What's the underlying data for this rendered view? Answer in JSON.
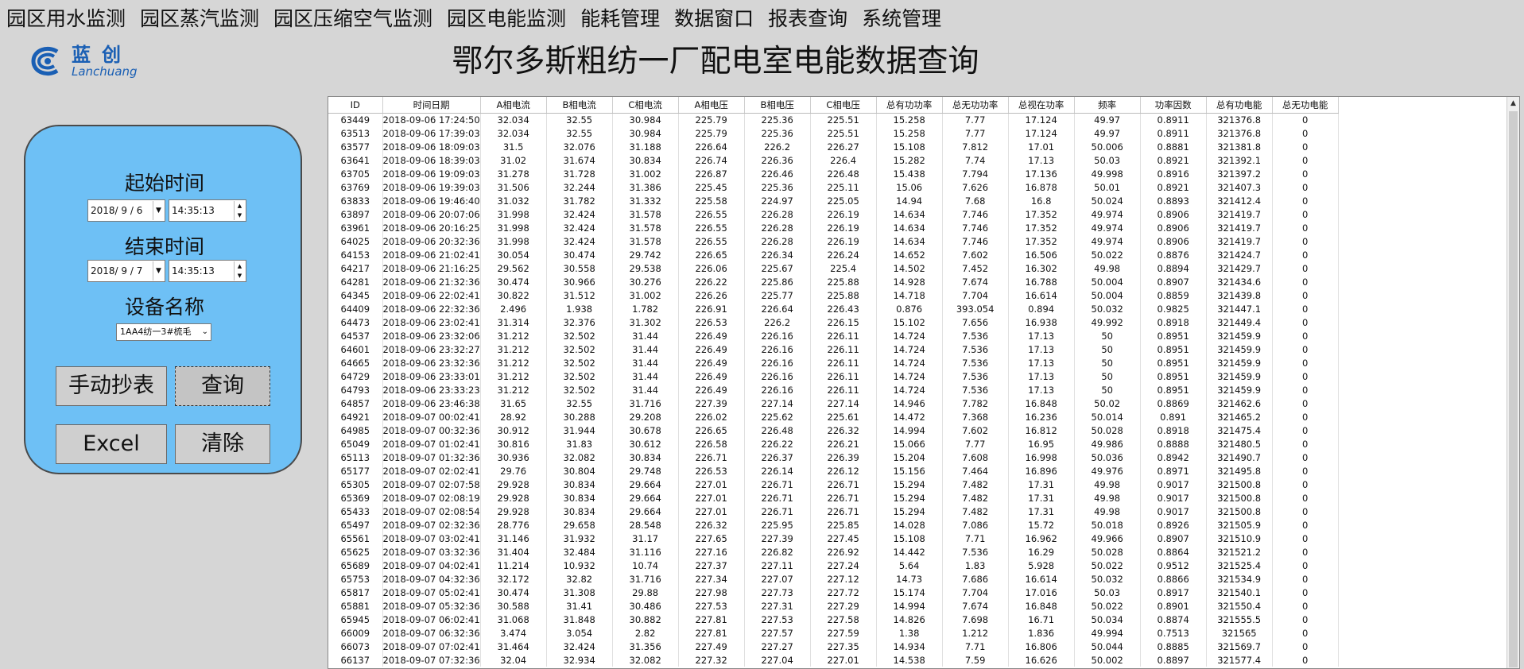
{
  "menu": [
    "园区用水监测",
    "园区蒸汽监测",
    "园区压缩空气监测",
    "园区电能监测",
    "能耗管理",
    "数据窗口",
    "报表查询",
    "系统管理"
  ],
  "logo": {
    "cn": "蓝创",
    "en": "Lanchuang",
    "brand_color": "#1a5fb4"
  },
  "page_title": "鄂尔多斯粗纺一厂配电室电能数据查询",
  "panel": {
    "start_label": "起始时间",
    "start_date": "2018/ 9 / 6",
    "start_time": "14:35:13",
    "end_label": "结束时间",
    "end_date": "2018/ 9 / 7",
    "end_time": "14:35:13",
    "device_label": "设备名称",
    "device_value": "1AA4纺一3#梳毛",
    "manual_read_btn": "手动抄表",
    "query_btn": "查询",
    "excel_btn": "Excel",
    "clear_btn": "清除",
    "bg_color": "#6ec0f5"
  },
  "table": {
    "columns": [
      "ID",
      "时间日期",
      "A相电流",
      "B相电流",
      "C相电流",
      "A相电压",
      "B相电压",
      "C相电压",
      "总有功功率",
      "总无功功率",
      "总视在功率",
      "频率",
      "功率因数",
      "总有功电能",
      "总无功电能"
    ],
    "rows": [
      [
        "63449",
        "2018-09-06 17:24:50",
        "32.034",
        "32.55",
        "30.984",
        "225.79",
        "225.36",
        "225.51",
        "15.258",
        "7.77",
        "17.124",
        "49.97",
        "0.8911",
        "321376.8",
        "0"
      ],
      [
        "63513",
        "2018-09-06 17:39:03",
        "32.034",
        "32.55",
        "30.984",
        "225.79",
        "225.36",
        "225.51",
        "15.258",
        "7.77",
        "17.124",
        "49.97",
        "0.8911",
        "321376.8",
        "0"
      ],
      [
        "63577",
        "2018-09-06 18:09:03",
        "31.5",
        "32.076",
        "31.188",
        "226.64",
        "226.2",
        "226.27",
        "15.108",
        "7.812",
        "17.01",
        "50.006",
        "0.8881",
        "321381.8",
        "0"
      ],
      [
        "63641",
        "2018-09-06 18:39:03",
        "31.02",
        "31.674",
        "30.834",
        "226.74",
        "226.36",
        "226.4",
        "15.282",
        "7.74",
        "17.13",
        "50.03",
        "0.8921",
        "321392.1",
        "0"
      ],
      [
        "63705",
        "2018-09-06 19:09:03",
        "31.278",
        "31.728",
        "31.002",
        "226.87",
        "226.46",
        "226.48",
        "15.438",
        "7.794",
        "17.136",
        "49.998",
        "0.8916",
        "321397.2",
        "0"
      ],
      [
        "63769",
        "2018-09-06 19:39:03",
        "31.506",
        "32.244",
        "31.386",
        "225.45",
        "225.36",
        "225.11",
        "15.06",
        "7.626",
        "16.878",
        "50.01",
        "0.8921",
        "321407.3",
        "0"
      ],
      [
        "63833",
        "2018-09-06 19:46:40",
        "31.032",
        "31.782",
        "31.332",
        "225.58",
        "224.97",
        "225.05",
        "14.94",
        "7.68",
        "16.8",
        "50.024",
        "0.8893",
        "321412.4",
        "0"
      ],
      [
        "63897",
        "2018-09-06 20:07:06",
        "31.998",
        "32.424",
        "31.578",
        "226.55",
        "226.28",
        "226.19",
        "14.634",
        "7.746",
        "17.352",
        "49.974",
        "0.8906",
        "321419.7",
        "0"
      ],
      [
        "63961",
        "2018-09-06 20:16:25",
        "31.998",
        "32.424",
        "31.578",
        "226.55",
        "226.28",
        "226.19",
        "14.634",
        "7.746",
        "17.352",
        "49.974",
        "0.8906",
        "321419.7",
        "0"
      ],
      [
        "64025",
        "2018-09-06 20:32:36",
        "31.998",
        "32.424",
        "31.578",
        "226.55",
        "226.28",
        "226.19",
        "14.634",
        "7.746",
        "17.352",
        "49.974",
        "0.8906",
        "321419.7",
        "0"
      ],
      [
        "64153",
        "2018-09-06 21:02:41",
        "30.054",
        "30.474",
        "29.742",
        "226.65",
        "226.34",
        "226.24",
        "14.652",
        "7.602",
        "16.506",
        "50.022",
        "0.8876",
        "321424.7",
        "0"
      ],
      [
        "64217",
        "2018-09-06 21:16:25",
        "29.562",
        "30.558",
        "29.538",
        "226.06",
        "225.67",
        "225.4",
        "14.502",
        "7.452",
        "16.302",
        "49.98",
        "0.8894",
        "321429.7",
        "0"
      ],
      [
        "64281",
        "2018-09-06 21:32:36",
        "30.474",
        "30.966",
        "30.276",
        "226.22",
        "225.86",
        "225.88",
        "14.928",
        "7.674",
        "16.788",
        "50.004",
        "0.8907",
        "321434.6",
        "0"
      ],
      [
        "64345",
        "2018-09-06 22:02:41",
        "30.822",
        "31.512",
        "31.002",
        "226.26",
        "225.77",
        "225.88",
        "14.718",
        "7.704",
        "16.614",
        "50.004",
        "0.8859",
        "321439.8",
        "0"
      ],
      [
        "64409",
        "2018-09-06 22:32:36",
        "2.496",
        "1.938",
        "1.782",
        "226.91",
        "226.64",
        "226.43",
        "0.876",
        "393.054",
        "0.894",
        "50.032",
        "0.9825",
        "321447.1",
        "0"
      ],
      [
        "64473",
        "2018-09-06 23:02:41",
        "31.314",
        "32.376",
        "31.302",
        "226.53",
        "226.2",
        "226.15",
        "15.102",
        "7.656",
        "16.938",
        "49.992",
        "0.8918",
        "321449.4",
        "0"
      ],
      [
        "64537",
        "2018-09-06 23:32:06",
        "31.212",
        "32.502",
        "31.44",
        "226.49",
        "226.16",
        "226.11",
        "14.724",
        "7.536",
        "17.13",
        "50",
        "0.8951",
        "321459.9",
        "0"
      ],
      [
        "64601",
        "2018-09-06 23:32:27",
        "31.212",
        "32.502",
        "31.44",
        "226.49",
        "226.16",
        "226.11",
        "14.724",
        "7.536",
        "17.13",
        "50",
        "0.8951",
        "321459.9",
        "0"
      ],
      [
        "64665",
        "2018-09-06 23:32:36",
        "31.212",
        "32.502",
        "31.44",
        "226.49",
        "226.16",
        "226.11",
        "14.724",
        "7.536",
        "17.13",
        "50",
        "0.8951",
        "321459.9",
        "0"
      ],
      [
        "64729",
        "2018-09-06 23:33:01",
        "31.212",
        "32.502",
        "31.44",
        "226.49",
        "226.16",
        "226.11",
        "14.724",
        "7.536",
        "17.13",
        "50",
        "0.8951",
        "321459.9",
        "0"
      ],
      [
        "64793",
        "2018-09-06 23:33:23",
        "31.212",
        "32.502",
        "31.44",
        "226.49",
        "226.16",
        "226.11",
        "14.724",
        "7.536",
        "17.13",
        "50",
        "0.8951",
        "321459.9",
        "0"
      ],
      [
        "64857",
        "2018-09-06 23:46:38",
        "31.65",
        "32.55",
        "31.716",
        "227.39",
        "227.14",
        "227.14",
        "14.946",
        "7.782",
        "16.848",
        "50.02",
        "0.8869",
        "321462.6",
        "0"
      ],
      [
        "64921",
        "2018-09-07 00:02:41",
        "28.92",
        "30.288",
        "29.208",
        "226.02",
        "225.62",
        "225.61",
        "14.472",
        "7.368",
        "16.236",
        "50.014",
        "0.891",
        "321465.2",
        "0"
      ],
      [
        "64985",
        "2018-09-07 00:32:36",
        "30.912",
        "31.944",
        "30.678",
        "226.65",
        "226.48",
        "226.32",
        "14.994",
        "7.602",
        "16.812",
        "50.028",
        "0.8918",
        "321475.4",
        "0"
      ],
      [
        "65049",
        "2018-09-07 01:02:41",
        "30.816",
        "31.83",
        "30.612",
        "226.58",
        "226.22",
        "226.21",
        "15.066",
        "7.77",
        "16.95",
        "49.986",
        "0.8888",
        "321480.5",
        "0"
      ],
      [
        "65113",
        "2018-09-07 01:32:36",
        "30.936",
        "32.082",
        "30.834",
        "226.71",
        "226.37",
        "226.39",
        "15.204",
        "7.608",
        "16.998",
        "50.036",
        "0.8942",
        "321490.7",
        "0"
      ],
      [
        "65177",
        "2018-09-07 02:02:41",
        "29.76",
        "30.804",
        "29.748",
        "226.53",
        "226.14",
        "226.12",
        "15.156",
        "7.464",
        "16.896",
        "49.976",
        "0.8971",
        "321495.8",
        "0"
      ],
      [
        "65305",
        "2018-09-07 02:07:58",
        "29.928",
        "30.834",
        "29.664",
        "227.01",
        "226.71",
        "226.71",
        "15.294",
        "7.482",
        "17.31",
        "49.98",
        "0.9017",
        "321500.8",
        "0"
      ],
      [
        "65369",
        "2018-09-07 02:08:19",
        "29.928",
        "30.834",
        "29.664",
        "227.01",
        "226.71",
        "226.71",
        "15.294",
        "7.482",
        "17.31",
        "49.98",
        "0.9017",
        "321500.8",
        "0"
      ],
      [
        "65433",
        "2018-09-07 02:08:54",
        "29.928",
        "30.834",
        "29.664",
        "227.01",
        "226.71",
        "226.71",
        "15.294",
        "7.482",
        "17.31",
        "49.98",
        "0.9017",
        "321500.8",
        "0"
      ],
      [
        "65497",
        "2018-09-07 02:32:36",
        "28.776",
        "29.658",
        "28.548",
        "226.32",
        "225.95",
        "225.85",
        "14.028",
        "7.086",
        "15.72",
        "50.018",
        "0.8926",
        "321505.9",
        "0"
      ],
      [
        "65561",
        "2018-09-07 03:02:41",
        "31.146",
        "31.932",
        "31.17",
        "227.65",
        "227.39",
        "227.45",
        "15.108",
        "7.71",
        "16.962",
        "49.966",
        "0.8907",
        "321510.9",
        "0"
      ],
      [
        "65625",
        "2018-09-07 03:32:36",
        "31.404",
        "32.484",
        "31.116",
        "227.16",
        "226.82",
        "226.92",
        "14.442",
        "7.536",
        "16.29",
        "50.028",
        "0.8864",
        "321521.2",
        "0"
      ],
      [
        "65689",
        "2018-09-07 04:02:41",
        "11.214",
        "10.932",
        "10.74",
        "227.37",
        "227.11",
        "227.24",
        "5.64",
        "1.83",
        "5.928",
        "50.022",
        "0.9512",
        "321525.4",
        "0"
      ],
      [
        "65753",
        "2018-09-07 04:32:36",
        "32.172",
        "32.82",
        "31.716",
        "227.34",
        "227.07",
        "227.12",
        "14.73",
        "7.686",
        "16.614",
        "50.032",
        "0.8866",
        "321534.9",
        "0"
      ],
      [
        "65817",
        "2018-09-07 05:02:41",
        "30.474",
        "31.308",
        "29.88",
        "227.98",
        "227.73",
        "227.72",
        "15.174",
        "7.704",
        "17.016",
        "50.03",
        "0.8917",
        "321540.1",
        "0"
      ],
      [
        "65881",
        "2018-09-07 05:32:36",
        "30.588",
        "31.41",
        "30.486",
        "227.53",
        "227.31",
        "227.29",
        "14.994",
        "7.674",
        "16.848",
        "50.022",
        "0.8901",
        "321550.4",
        "0"
      ],
      [
        "65945",
        "2018-09-07 06:02:41",
        "31.068",
        "31.848",
        "30.882",
        "227.81",
        "227.53",
        "227.58",
        "14.826",
        "7.698",
        "16.71",
        "50.034",
        "0.8874",
        "321555.5",
        "0"
      ],
      [
        "66009",
        "2018-09-07 06:32:36",
        "3.474",
        "3.054",
        "2.82",
        "227.81",
        "227.57",
        "227.59",
        "1.38",
        "1.212",
        "1.836",
        "49.994",
        "0.7513",
        "321565",
        "0"
      ],
      [
        "66073",
        "2018-09-07 07:02:41",
        "31.464",
        "32.424",
        "31.356",
        "227.49",
        "227.27",
        "227.35",
        "14.934",
        "7.71",
        "16.806",
        "50.044",
        "0.8885",
        "321569.7",
        "0"
      ],
      [
        "66137",
        "2018-09-07 07:32:36",
        "32.04",
        "32.934",
        "32.082",
        "227.32",
        "227.04",
        "227.01",
        "14.538",
        "7.59",
        "16.626",
        "50.002",
        "0.8897",
        "321577.4",
        "0"
      ]
    ]
  }
}
